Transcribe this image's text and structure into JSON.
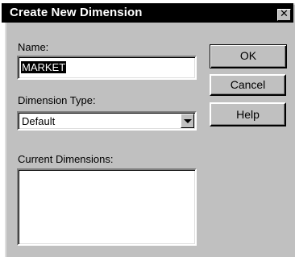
{
  "window": {
    "title": "Create New Dimension",
    "close_glyph": "✕"
  },
  "form": {
    "name_label": "Name:",
    "name_value": "MARKET",
    "type_label": "Dimension Type:",
    "type_selected": "Default",
    "current_label": "Current Dimensions:",
    "current_items": []
  },
  "buttons": {
    "ok": "OK",
    "cancel": "Cancel",
    "help": "Help"
  },
  "colors": {
    "face": "#c0c0c0",
    "titlebar": "#000000",
    "selection": "#000000"
  }
}
